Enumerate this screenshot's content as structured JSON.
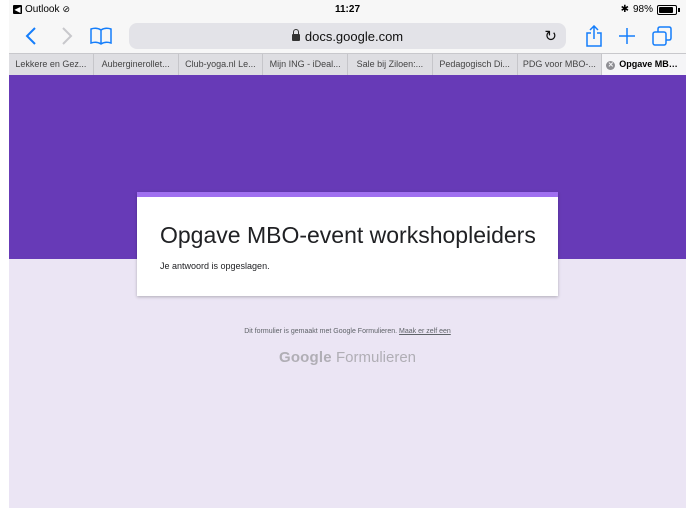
{
  "status_bar": {
    "back_app_label": "Outlook",
    "time": "11:27",
    "bluetooth_glyph": "✱",
    "battery_percent": "98%",
    "battery_level": 0.98
  },
  "toolbar": {
    "url": "docs.google.com"
  },
  "tabs": [
    {
      "label": "Lekkere en Gez..."
    },
    {
      "label": "Auberginerollet..."
    },
    {
      "label": "Club-yoga.nl Le..."
    },
    {
      "label": "Mijn ING - iDeal..."
    },
    {
      "label": "Sale bij Ziloen:..."
    },
    {
      "label": "Pedagogisch Di..."
    },
    {
      "label": "PDG voor MBO-..."
    },
    {
      "label": "Opgave MBO..."
    }
  ],
  "form": {
    "title": "Opgave MBO-event workshopleiders",
    "confirmation": "Je antwoord is opgeslagen."
  },
  "footer": {
    "note_text": "Dit formulier is gemaakt met Google Formulieren.",
    "link_text": "Maak er zelf een",
    "brand_google": "Google",
    "brand_product": "Formulieren"
  },
  "colors": {
    "header_purple": "#673ab7",
    "accent_stripe": "#a070f0",
    "page_background": "#ebe5f4",
    "ios_blue": "#157efb"
  }
}
